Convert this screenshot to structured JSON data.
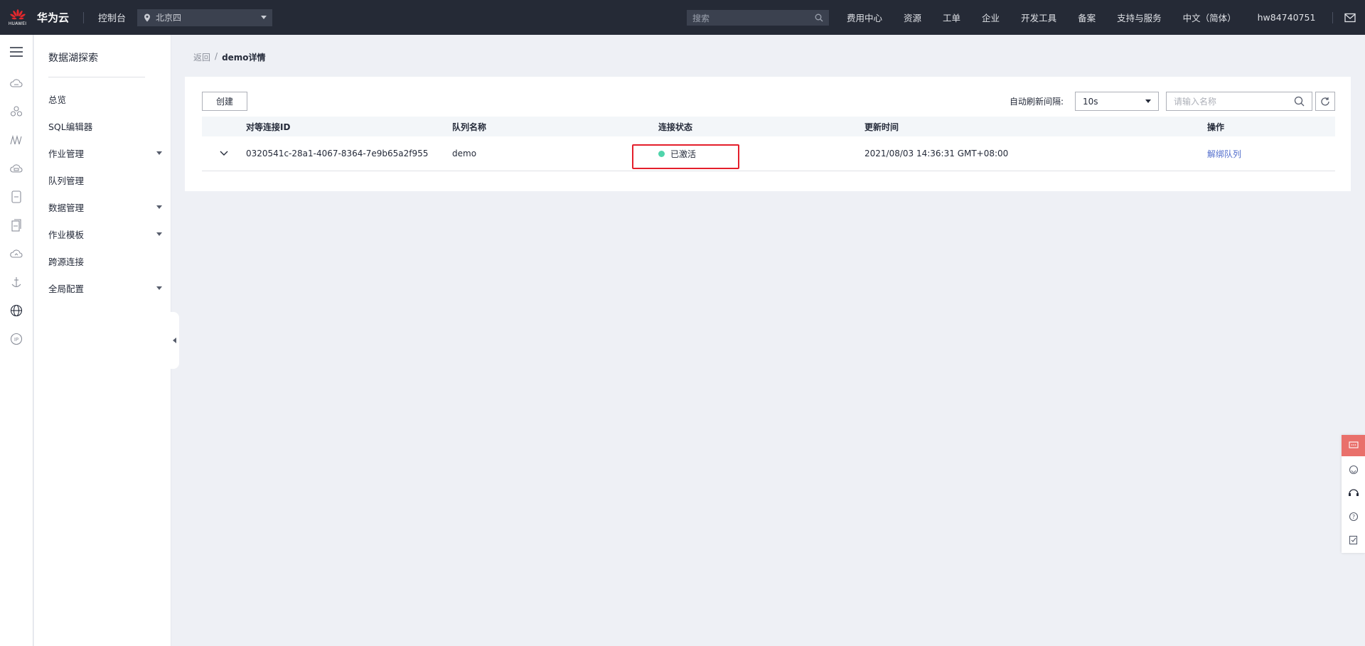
{
  "topbar": {
    "logo_text": "HUAWEI",
    "brand": "华为云",
    "console": "控制台",
    "region": "北京四",
    "search_placeholder": "搜索",
    "nav": [
      "费用中心",
      "资源",
      "工单",
      "企业",
      "开发工具",
      "备案",
      "支持与服务",
      "中文（简体）"
    ],
    "user": "hw84740751"
  },
  "sidenav": {
    "title": "数据湖探索",
    "items": [
      {
        "label": "总览",
        "expandable": false
      },
      {
        "label": "SQL编辑器",
        "expandable": false
      },
      {
        "label": "作业管理",
        "expandable": true
      },
      {
        "label": "队列管理",
        "expandable": false
      },
      {
        "label": "数据管理",
        "expandable": true
      },
      {
        "label": "作业模板",
        "expandable": true
      },
      {
        "label": "跨源连接",
        "expandable": false
      },
      {
        "label": "全局配置",
        "expandable": true
      }
    ]
  },
  "breadcrumb": {
    "back": "返回",
    "sep": "/",
    "current": "demo详情"
  },
  "toolbar": {
    "create_label": "创建",
    "refresh_label": "自动刷新间隔:",
    "interval_value": "10s",
    "search_placeholder": "请输入名称"
  },
  "table": {
    "headers": [
      "对等连接ID",
      "队列名称",
      "连接状态",
      "更新时间",
      "操作"
    ],
    "rows": [
      {
        "id": "0320541c-28a1-4067-8364-7e9b65a2f955",
        "queue": "demo",
        "status": "已激活",
        "updated": "2021/08/03 14:36:31 GMT+08:00",
        "action": "解绑队列"
      }
    ]
  },
  "colors": {
    "topbar_bg": "#252a36",
    "accent_link": "#526ecc",
    "status_active": "#50d4ab",
    "highlight_box": "#e41f2b"
  }
}
